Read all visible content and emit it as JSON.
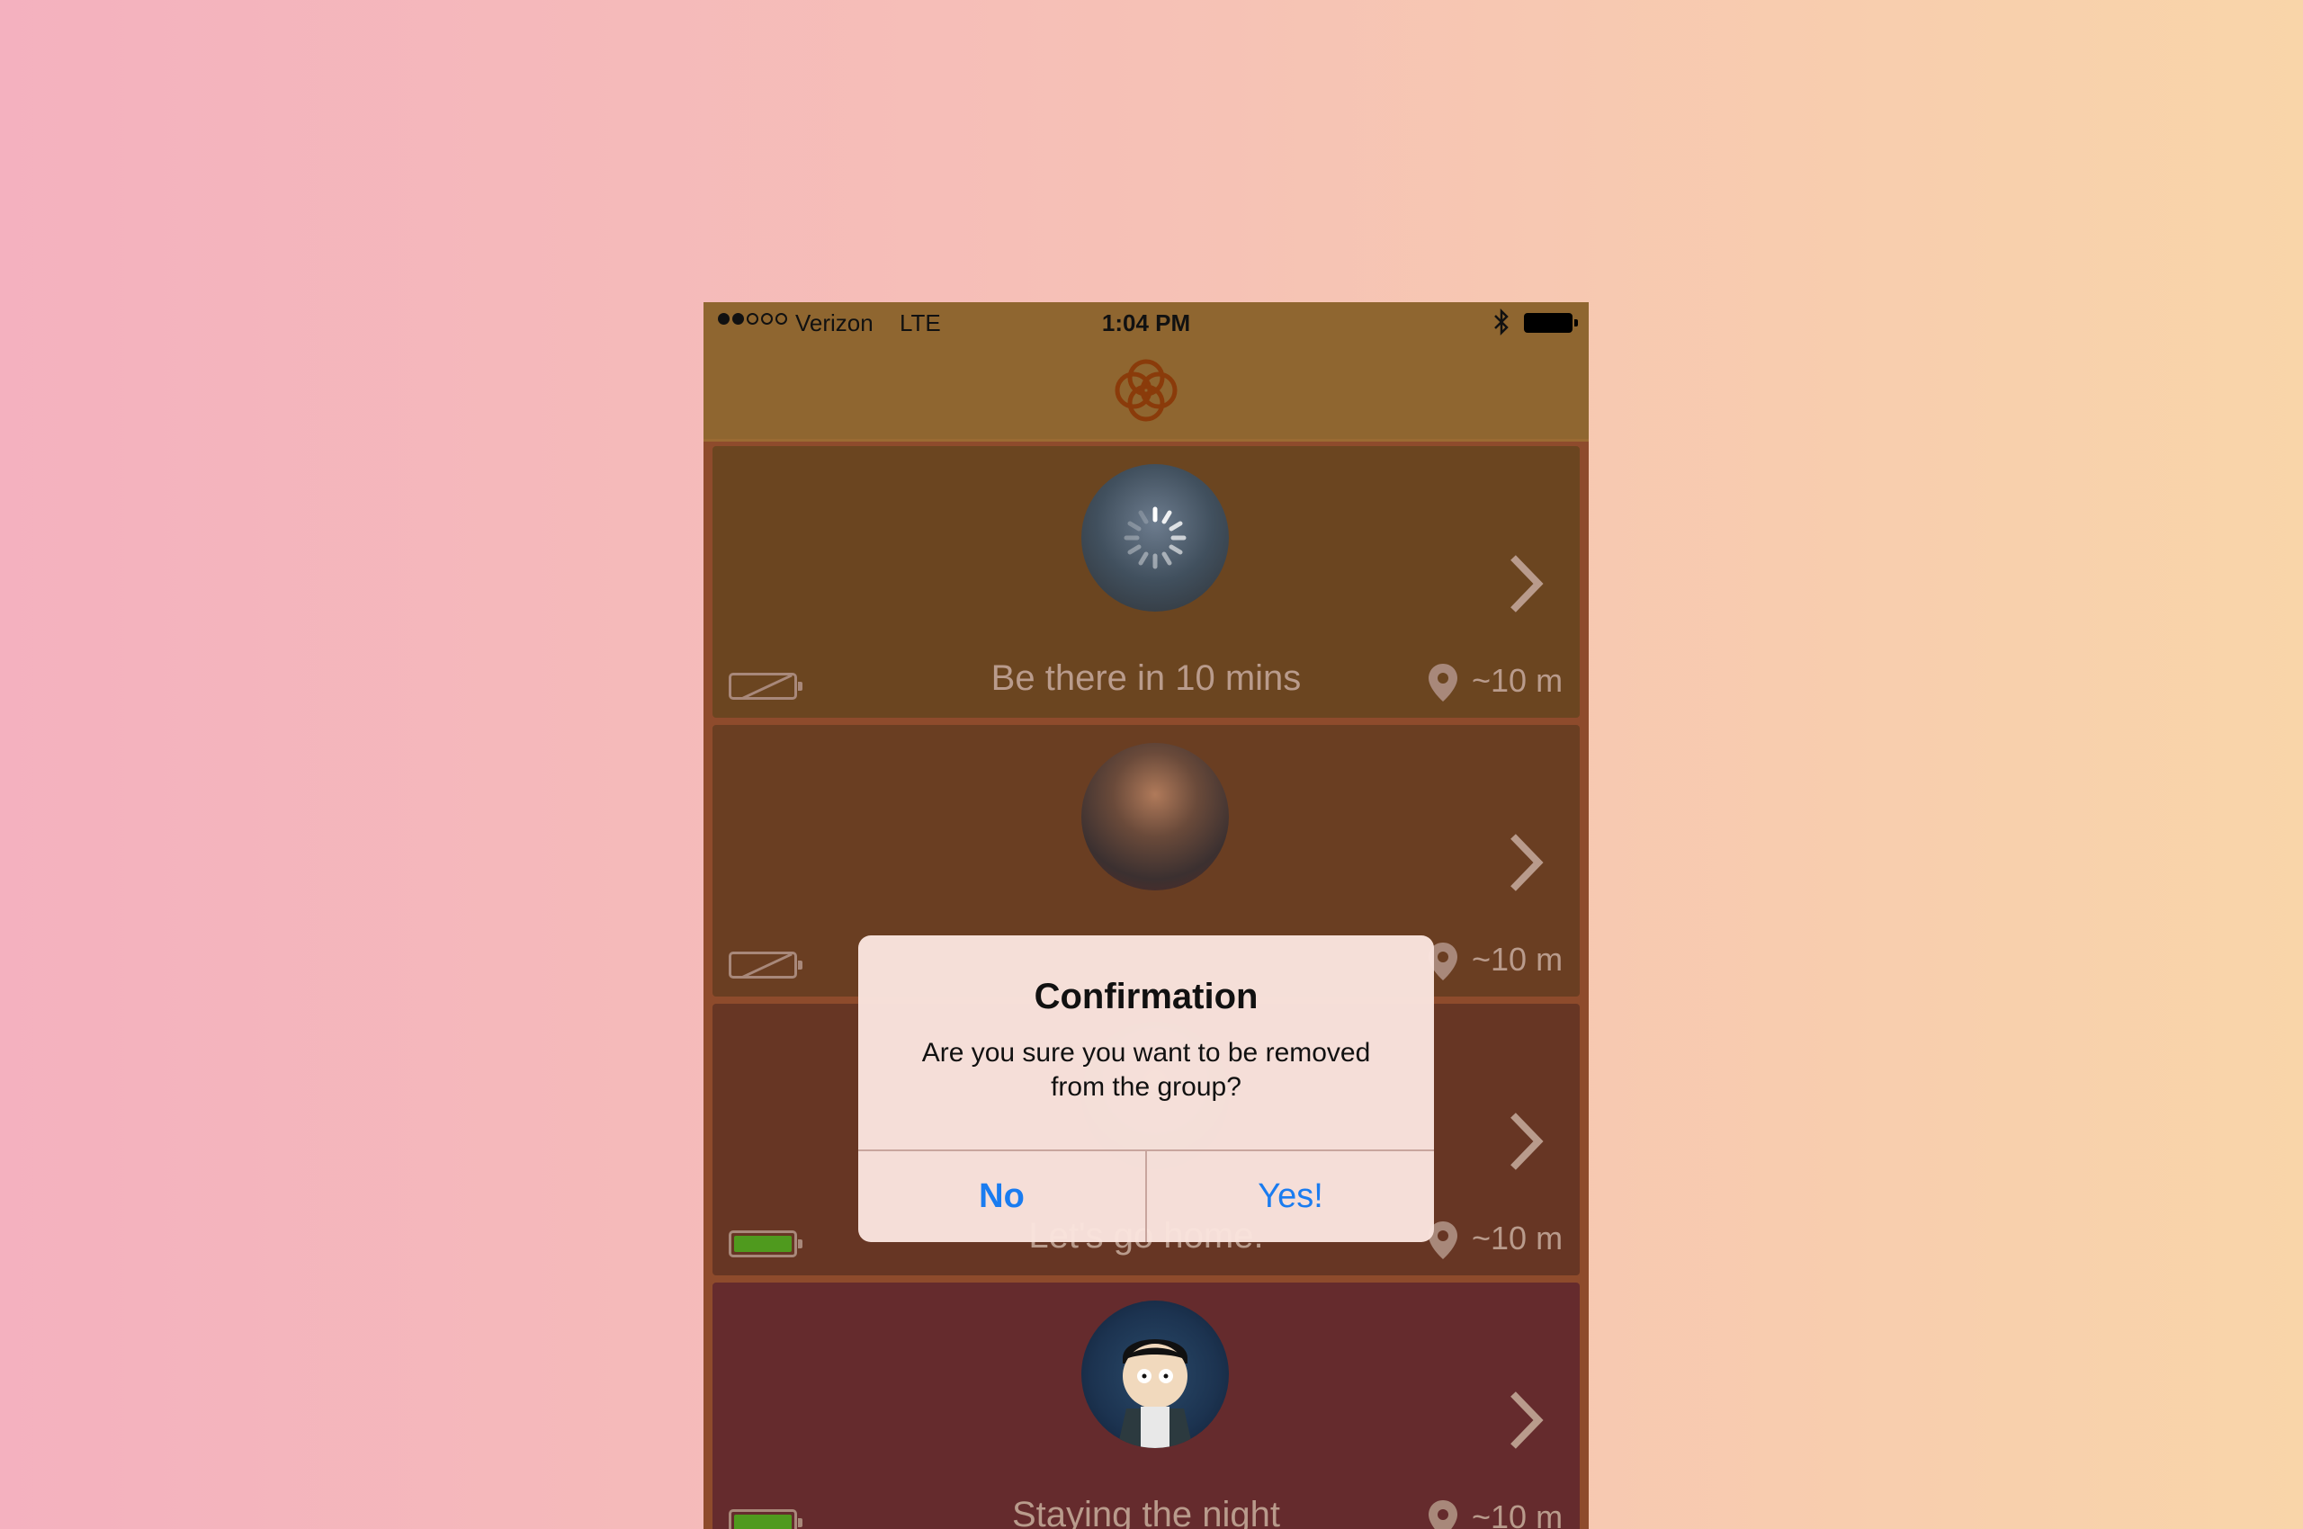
{
  "status_bar": {
    "carrier": "Verizon",
    "network": "LTE",
    "time": "1:04 PM",
    "signal_bars_on": 2,
    "signal_bars_total": 5
  },
  "app": {
    "logo_icon": "knot-logo-icon",
    "logo_color": "#8a3b0a"
  },
  "members": [
    {
      "status_text": "Be there in 10 mins",
      "distance": "~10 m",
      "battery": "low",
      "avatar": "photo-loading"
    },
    {
      "status_text": "",
      "distance": "~10 m",
      "battery": "low",
      "avatar": "photo-curly-hair"
    },
    {
      "status_text": "Let's go home.",
      "distance": "~10 m",
      "battery": "full",
      "avatar": "photo"
    },
    {
      "status_text": "Staying the night",
      "distance": "~10 m",
      "battery": "full",
      "avatar": "cartoon"
    }
  ],
  "dialog": {
    "title": "Confirmation",
    "message": "Are you sure you want to be removed from the group?",
    "no_label": "No",
    "yes_label": "Yes!",
    "button_color": "#1a7cf0"
  },
  "colors": {
    "battery_full": "#4f9a1e"
  }
}
